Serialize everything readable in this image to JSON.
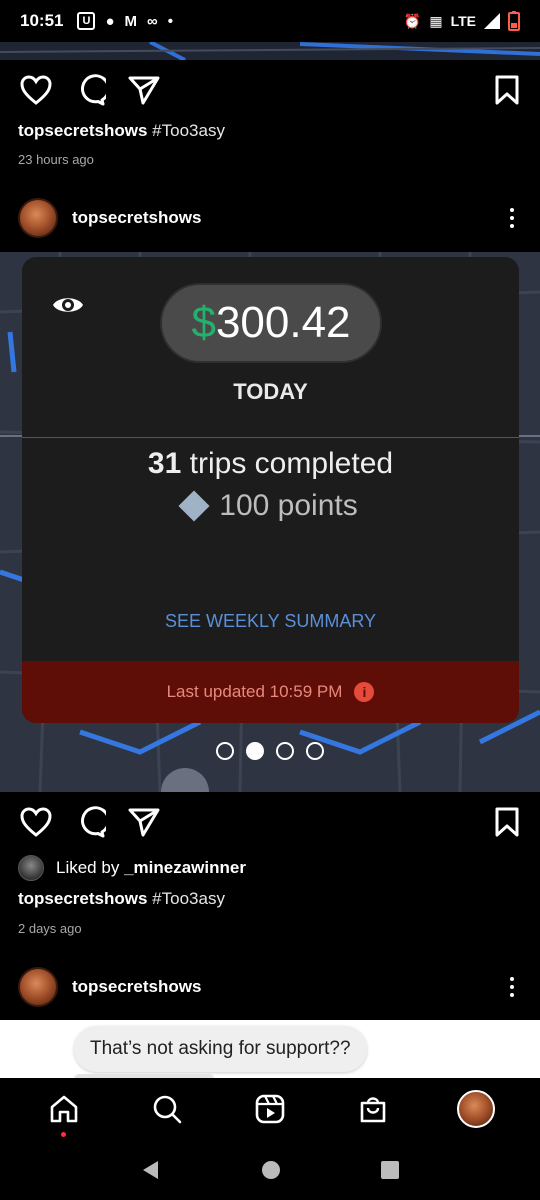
{
  "status_bar": {
    "time": "10:51",
    "left_icons": [
      "u-app-icon",
      "chat-icon",
      "gmail-icon",
      "voicemail-icon",
      "dot-icon"
    ],
    "right_icons": [
      "alarm-icon",
      "vibrate-icon",
      "signal-icon",
      "battery-icon"
    ],
    "network": "LTE"
  },
  "post1": {
    "caption_user": "topsecretshows",
    "caption_tag": "#Too3asy",
    "time_ago": "23 hours ago"
  },
  "post2": {
    "username": "topsecretshows",
    "card": {
      "currency": "$",
      "amount": "300.42",
      "period": "TODAY",
      "trips_count": "31",
      "trips_label": "trips completed",
      "points": "100 points",
      "weekly_link": "SEE WEEKLY SUMMARY",
      "last_updated": "Last updated 10:59 PM"
    },
    "carousel_count": 4,
    "carousel_active": 2,
    "liked_prefix": "Liked by",
    "liked_by": "_minezawinner",
    "caption_user": "topsecretshows",
    "caption_tag": "#Too3asy",
    "time_ago": "2 days ago"
  },
  "post3": {
    "username": "topsecretshows",
    "comment_bubble": "That’s not asking for support??"
  },
  "bottom_nav": {
    "items": [
      "home-icon",
      "search-icon",
      "reels-icon",
      "shop-icon",
      "profile-avatar"
    ]
  },
  "system_nav": {
    "items": [
      "back-icon",
      "home-circle-icon",
      "recents-icon"
    ]
  },
  "colors": {
    "uber_green": "#23b26b",
    "weekly_link": "#5b8fd8",
    "alert_bar": "#5e0d07",
    "alert_text": "#e8897d",
    "notification_dot": "#ff3040"
  }
}
